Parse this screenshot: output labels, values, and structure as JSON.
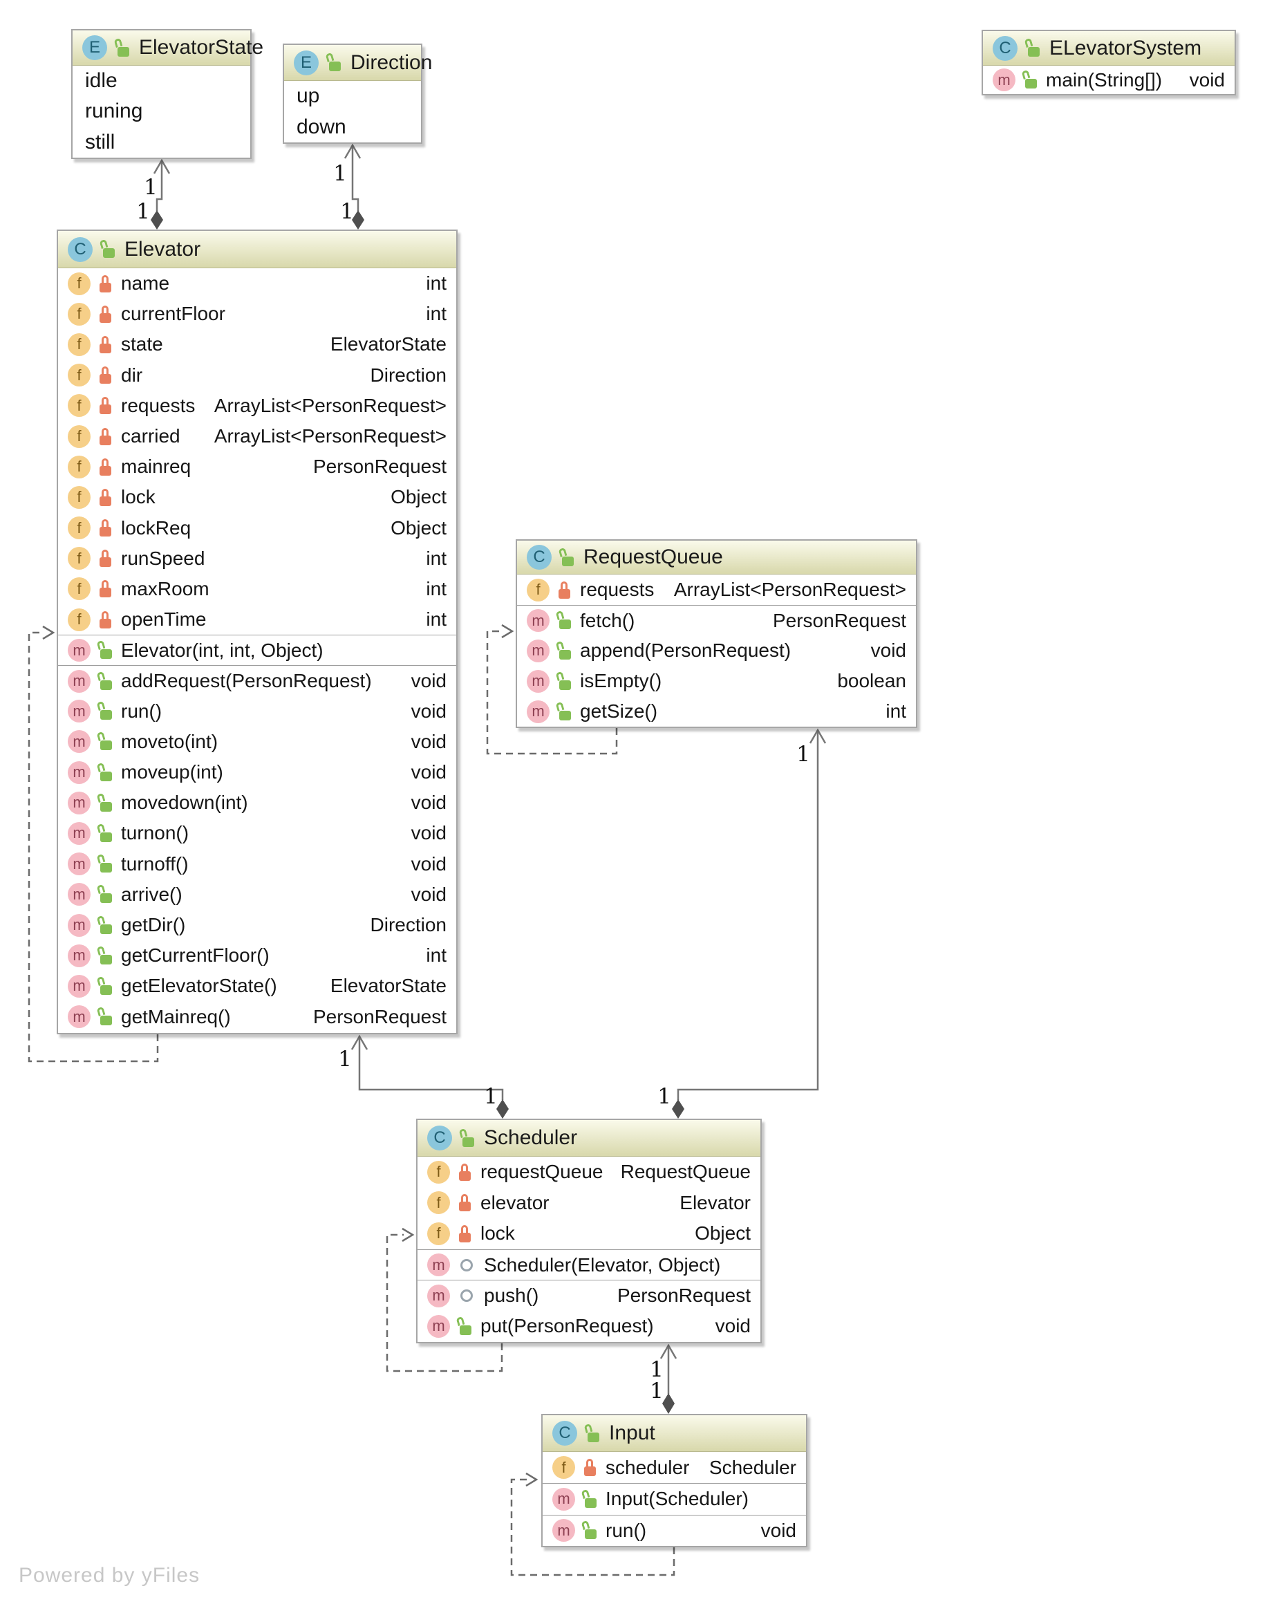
{
  "watermark": "Powered by yFiles",
  "icons": {
    "enum_letter": "E",
    "class_letter": "C",
    "field_letter": "f",
    "method_letter": "m"
  },
  "colors": {
    "header_gradient_top": "#fafaeb",
    "header_gradient_bottom": "#d8d8ab",
    "box_border": "#a6a6a6",
    "edge_solid": "#767676",
    "edge_dashed": "#6b6b6b",
    "diamond_fill": "#4f4f4f",
    "class_icon_bg": "#8ac6dc",
    "field_icon_bg": "#f6cf88",
    "method_icon_bg": "#f5b9c3",
    "lock_public_green": "#85bf55",
    "lock_private_orange": "#e87f5f",
    "watermark_grey": "#c7c7c7"
  },
  "enums": {
    "elevator_state": {
      "title": "ElevatorState",
      "items": [
        "idle",
        "runing",
        "still"
      ]
    },
    "direction": {
      "title": "Direction",
      "items": [
        "up",
        "down"
      ]
    }
  },
  "classes": {
    "elevator_system": {
      "title": "ELevatorSystem",
      "methods": [
        {
          "name": "main(String[])",
          "type": "void",
          "visibility": "public",
          "static": true
        }
      ]
    },
    "elevator": {
      "title": "Elevator",
      "fields": [
        {
          "name": "name",
          "type": "int",
          "visibility": "private"
        },
        {
          "name": "currentFloor",
          "type": "int",
          "visibility": "private"
        },
        {
          "name": "state",
          "type": "ElevatorState",
          "visibility": "private"
        },
        {
          "name": "dir",
          "type": "Direction",
          "visibility": "private"
        },
        {
          "name": "requests",
          "type": "ArrayList<PersonRequest>",
          "visibility": "private"
        },
        {
          "name": "carried",
          "type": "ArrayList<PersonRequest>",
          "visibility": "private"
        },
        {
          "name": "mainreq",
          "type": "PersonRequest",
          "visibility": "private"
        },
        {
          "name": "lock",
          "type": "Object",
          "visibility": "private"
        },
        {
          "name": "lockReq",
          "type": "Object",
          "visibility": "private"
        },
        {
          "name": "runSpeed",
          "type": "int",
          "visibility": "private"
        },
        {
          "name": "maxRoom",
          "type": "int",
          "visibility": "private"
        },
        {
          "name": "openTime",
          "type": "int",
          "visibility": "private"
        }
      ],
      "constructors": [
        {
          "name": "Elevator(int, int, Object)",
          "type": "",
          "visibility": "public"
        }
      ],
      "methods": [
        {
          "name": "addRequest(PersonRequest)",
          "type": "void",
          "visibility": "public"
        },
        {
          "name": "run()",
          "type": "void",
          "visibility": "public"
        },
        {
          "name": "moveto(int)",
          "type": "void",
          "visibility": "public"
        },
        {
          "name": "moveup(int)",
          "type": "void",
          "visibility": "public"
        },
        {
          "name": "movedown(int)",
          "type": "void",
          "visibility": "public"
        },
        {
          "name": "turnon()",
          "type": "void",
          "visibility": "public"
        },
        {
          "name": "turnoff()",
          "type": "void",
          "visibility": "public"
        },
        {
          "name": "arrive()",
          "type": "void",
          "visibility": "public"
        },
        {
          "name": "getDir()",
          "type": "Direction",
          "visibility": "public"
        },
        {
          "name": "getCurrentFloor()",
          "type": "int",
          "visibility": "public"
        },
        {
          "name": "getElevatorState()",
          "type": "ElevatorState",
          "visibility": "public"
        },
        {
          "name": "getMainreq()",
          "type": "PersonRequest",
          "visibility": "public"
        }
      ]
    },
    "request_queue": {
      "title": "RequestQueue",
      "fields": [
        {
          "name": "requests",
          "type": "ArrayList<PersonRequest>",
          "visibility": "private"
        }
      ],
      "methods": [
        {
          "name": "fetch()",
          "type": "PersonRequest",
          "visibility": "public"
        },
        {
          "name": "append(PersonRequest)",
          "type": "void",
          "visibility": "public"
        },
        {
          "name": "isEmpty()",
          "type": "boolean",
          "visibility": "public"
        },
        {
          "name": "getSize()",
          "type": "int",
          "visibility": "public"
        }
      ]
    },
    "scheduler": {
      "title": "Scheduler",
      "fields": [
        {
          "name": "requestQueue",
          "type": "RequestQueue",
          "visibility": "private"
        },
        {
          "name": "elevator",
          "type": "Elevator",
          "visibility": "private"
        },
        {
          "name": "lock",
          "type": "Object",
          "visibility": "private"
        }
      ],
      "constructors": [
        {
          "name": "Scheduler(Elevator, Object)",
          "type": "",
          "visibility": "package"
        }
      ],
      "methods": [
        {
          "name": "push()",
          "type": "PersonRequest",
          "visibility": "package"
        },
        {
          "name": "put(PersonRequest)",
          "type": "void",
          "visibility": "public"
        }
      ]
    },
    "input": {
      "title": "Input",
      "fields": [
        {
          "name": "scheduler",
          "type": "Scheduler",
          "visibility": "private"
        }
      ],
      "constructors": [
        {
          "name": "Input(Scheduler)",
          "type": "",
          "visibility": "public"
        }
      ],
      "methods": [
        {
          "name": "run()",
          "type": "void",
          "visibility": "public"
        }
      ]
    }
  },
  "relations": [
    {
      "type": "composition",
      "from": "Elevator",
      "to": "ElevatorState",
      "from_label": "1",
      "to_label": "1"
    },
    {
      "type": "composition",
      "from": "Elevator",
      "to": "Direction",
      "from_label": "1",
      "to_label": "1"
    },
    {
      "type": "composition",
      "from": "Scheduler",
      "to": "Elevator",
      "from_label": "1",
      "to_label": "1"
    },
    {
      "type": "composition",
      "from": "Scheduler",
      "to": "RequestQueue",
      "from_label": "1",
      "to_label": "1"
    },
    {
      "type": "composition",
      "from": "Input",
      "to": "Scheduler",
      "from_label": "1",
      "to_label": "1"
    },
    {
      "type": "dependency",
      "from": "Elevator",
      "to": "Elevator"
    },
    {
      "type": "dependency",
      "from": "RequestQueue",
      "to": "RequestQueue"
    },
    {
      "type": "dependency",
      "from": "Scheduler",
      "to": "Scheduler"
    },
    {
      "type": "dependency",
      "from": "Input",
      "to": "Input"
    }
  ]
}
